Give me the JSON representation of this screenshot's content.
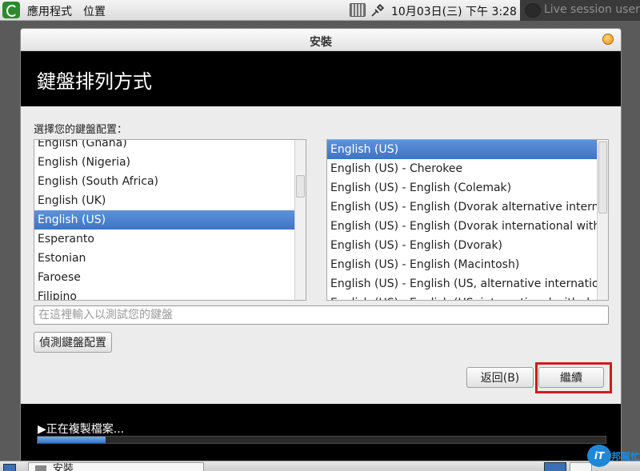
{
  "top_panel": {
    "menu_applications": "應用程式",
    "menu_places": "位置",
    "clock": "10月03日(三) 下午  3:28",
    "session": "Live session user"
  },
  "window": {
    "title": "安裝",
    "heading": "鍵盤排列方式",
    "prompt": "選擇您的鍵盤配置：",
    "layouts": [
      "English (Ghana)",
      "English (Nigeria)",
      "English (South Africa)",
      "English (UK)",
      "English (US)",
      "Esperanto",
      "Estonian",
      "Faroese",
      "Filipino"
    ],
    "layouts_selected": "English (US)",
    "variants": [
      "English (US)",
      "English (US) - Cherokee",
      "English (US) - English (Colemak)",
      "English (US) - English (Dvorak alternative international no dead keys)",
      "English (US) - English (Dvorak international with dead keys)",
      "English (US) - English (Dvorak)",
      "English (US) - English (Macintosh)",
      "English (US) - English (US, alternative international)",
      "English (US) - English (US, international with dead keys)"
    ],
    "variants_selected": "English (US)",
    "test_placeholder": "在這裡輸入以測試您的鍵盤",
    "detect_label": "偵測鍵盤配置",
    "back_label": "返回(B)",
    "continue_label": "繼續",
    "status_text": "正在複製檔案...",
    "progress": 0.12
  },
  "taskbar": {
    "task_label": "安裝"
  },
  "watermark": {
    "circle": "iT",
    "text": "邦幫忙"
  },
  "colors": {
    "selection": "#3c74c6",
    "highlight": "#d21b1b",
    "band": "#000000"
  }
}
